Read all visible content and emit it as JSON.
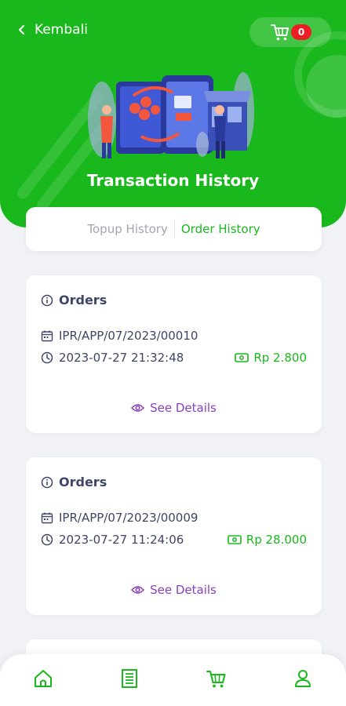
{
  "header": {
    "back_label": "Kembali",
    "cart_count": "0",
    "title": "Transaction History"
  },
  "tabs": [
    {
      "label": "Topup History",
      "active": false
    },
    {
      "label": "Order History",
      "active": true
    }
  ],
  "orders": [
    {
      "heading": "Orders",
      "order_id": "IPR/APP/07/2023/00010",
      "datetime": "2023-07-27 21:32:48",
      "amount": "Rp 2.800",
      "details_label": "See Details"
    },
    {
      "heading": "Orders",
      "order_id": "IPR/APP/07/2023/00009",
      "datetime": "2023-07-27 11:24:06",
      "amount": "Rp 28.000",
      "details_label": "See Details"
    }
  ],
  "bottom_nav": [
    {
      "icon": "home-icon"
    },
    {
      "icon": "receipt-icon"
    },
    {
      "icon": "cart-icon"
    },
    {
      "icon": "user-icon"
    }
  ],
  "colors": {
    "brand_green": "#19b81c",
    "text_dark": "#3f4566",
    "details_purple": "#8a3fbf",
    "badge_red": "#ee1d24",
    "background": "#f1f2f6"
  }
}
